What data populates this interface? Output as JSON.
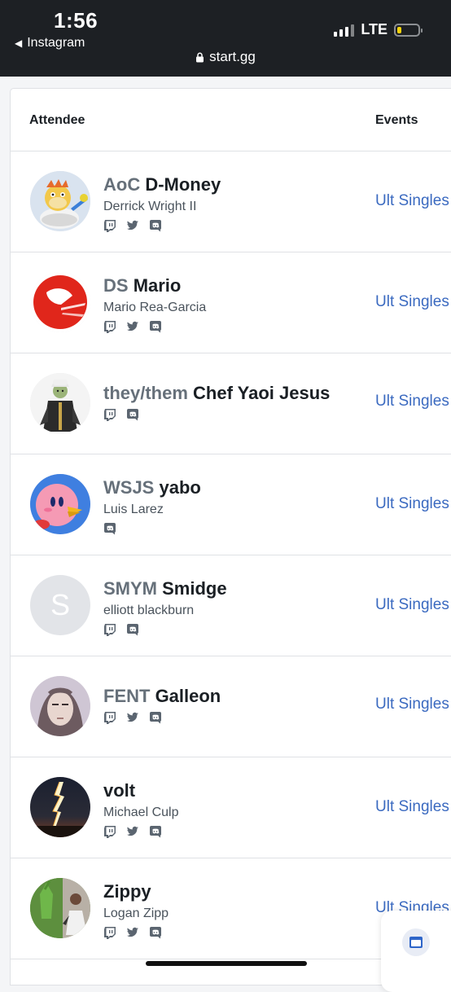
{
  "status_bar": {
    "time": "1:56",
    "back_app": "Instagram",
    "url": "start.gg",
    "network": "LTE",
    "battery_level": 0.2,
    "battery_color": "#f5d30b"
  },
  "table": {
    "col_attendee": "Attendee",
    "col_events": "Events",
    "rows": [
      {
        "prefix": "AoC",
        "tag": "D-Money",
        "name": "Derrick Wright II",
        "socials": [
          "twitch-icon",
          "twitter-icon",
          "discord-icon"
        ],
        "event": "Ult Singles",
        "avatar": "bowser-jr"
      },
      {
        "prefix": "DS",
        "tag": "Mario",
        "name": "Mario Rea-Garcia",
        "socials": [
          "twitch-icon",
          "twitter-icon",
          "discord-icon"
        ],
        "event": "Ult Singles",
        "avatar": "red-cap"
      },
      {
        "prefix": "they/them",
        "tag": "Chef Yaoi Jesus",
        "name": "",
        "socials": [
          "twitch-icon",
          "discord-icon"
        ],
        "event": "Ult Singles",
        "avatar": "cloaked-figure"
      },
      {
        "prefix": "WSJS",
        "tag": "yabo",
        "name": "Luis Larez",
        "socials": [
          "discord-icon"
        ],
        "event": "Ult Singles",
        "avatar": "kirby"
      },
      {
        "prefix": "SMYM",
        "tag": "Smidge",
        "name": "elliott blackburn",
        "socials": [
          "twitch-icon",
          "discord-icon"
        ],
        "event": "Ult Singles",
        "avatar": "letter",
        "avatar_letter": "S"
      },
      {
        "prefix": "FENT",
        "tag": "Galleon",
        "name": "",
        "socials": [
          "twitch-icon",
          "twitter-icon",
          "discord-icon"
        ],
        "event": "Ult Singles",
        "avatar": "anime-face"
      },
      {
        "prefix": "",
        "tag": "volt",
        "name": "Michael Culp",
        "socials": [
          "twitch-icon",
          "twitter-icon",
          "discord-icon"
        ],
        "event": "Ult Singles",
        "avatar": "lightning"
      },
      {
        "prefix": "",
        "tag": "Zippy",
        "name": "Logan Zipp",
        "socials": [
          "twitch-icon",
          "twitter-icon",
          "discord-icon"
        ],
        "event": "Ult Singles",
        "avatar": "photo"
      }
    ]
  },
  "colors": {
    "link": "#3b6ac0",
    "prefix": "#66707a",
    "statusbar_bg": "#1d2024"
  }
}
